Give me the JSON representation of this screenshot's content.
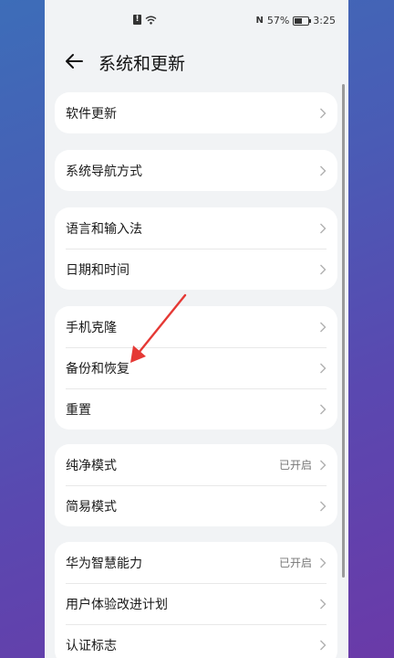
{
  "status_bar": {
    "nfc": "N",
    "battery": "57%",
    "time": "3:25"
  },
  "header": {
    "title": "系统和更新"
  },
  "groups": [
    {
      "items": [
        {
          "label": "软件更新",
          "value": ""
        }
      ]
    },
    {
      "items": [
        {
          "label": "系统导航方式",
          "value": ""
        }
      ]
    },
    {
      "items": [
        {
          "label": "语言和输入法",
          "value": ""
        },
        {
          "label": "日期和时间",
          "value": ""
        }
      ]
    },
    {
      "items": [
        {
          "label": "手机克隆",
          "value": ""
        },
        {
          "label": "备份和恢复",
          "value": ""
        },
        {
          "label": "重置",
          "value": ""
        }
      ]
    },
    {
      "items": [
        {
          "label": "纯净模式",
          "value": "已开启"
        },
        {
          "label": "简易模式",
          "value": ""
        }
      ]
    },
    {
      "items": [
        {
          "label": "华为智慧能力",
          "value": "已开启"
        },
        {
          "label": "用户体验改进计划",
          "value": ""
        },
        {
          "label": "认证标志",
          "value": ""
        }
      ]
    }
  ],
  "colors": {
    "annotation_arrow": "#e53935",
    "chevron": "#b0b0b0"
  }
}
